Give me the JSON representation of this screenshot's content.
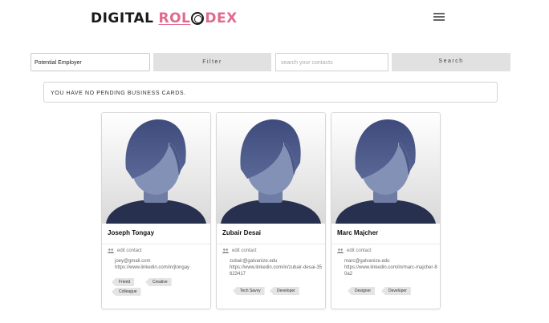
{
  "header": {
    "logo_part1": "DIGITAL",
    "logo_part2": "ROL",
    "logo_part3": "DEX",
    "menu_icon": "hamburger-icon"
  },
  "toolbar": {
    "filter_value": "Potential Employer",
    "filter_button": "Filter",
    "search_placeholder": "search your contacts",
    "search_button": "Search"
  },
  "notice": "YOU HAVE NO PENDING BUSINESS CARDS.",
  "contacts": [
    {
      "name": "Joseph Tongay",
      "edit_label": "edit contact",
      "email": "joey@gmail.com",
      "linkedin": "https://www.linkedin.com/in/jtongay",
      "tags": [
        "Friend",
        "Creative",
        "Colleague"
      ]
    },
    {
      "name": "Zubair Desai",
      "edit_label": "edit contact",
      "email": "zubair@galvanize.edu",
      "linkedin": "https://www.linkedin.com/in/zubair-desai-35623417",
      "tags": [
        "Tech Savvy",
        "Developer"
      ]
    },
    {
      "name": "Marc Majcher",
      "edit_label": "edit contact",
      "email": "marc@galvanize.edu",
      "linkedin": "https://www.linkedin.com/in/marc-majcher-80a2",
      "tags": [
        "Designer",
        "Developer"
      ]
    }
  ],
  "colors": {
    "accent": "#e06a8e",
    "avatar_face": "#7d8bb0",
    "avatar_hair": "#3d4a7a",
    "avatar_shirt": "#28304f"
  }
}
